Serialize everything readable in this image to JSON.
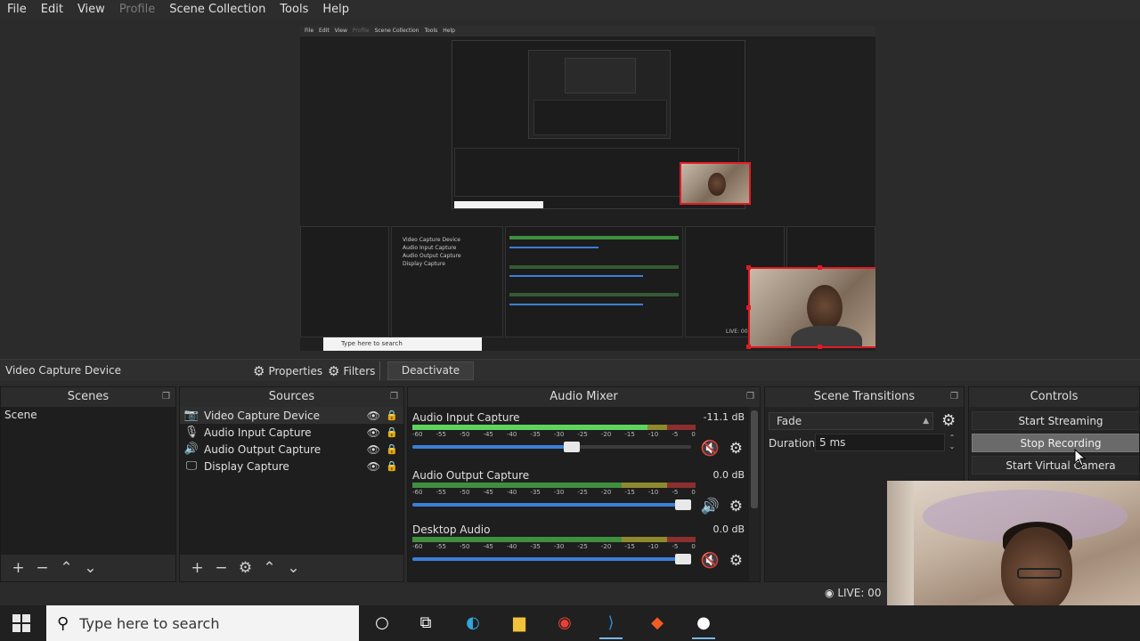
{
  "menu": [
    "File",
    "Edit",
    "View",
    "Profile",
    "Scene Collection",
    "Tools",
    "Help"
  ],
  "menu_disabled": [
    "Profile"
  ],
  "preview": {
    "nested_menu": [
      "File",
      "Edit",
      "View",
      "Profile",
      "Scene Collection",
      "Tools",
      "Help"
    ],
    "nested_search": "Type here to search",
    "nested_live": "LIVE: 00"
  },
  "source_toolbar": {
    "source_name": "Video Capture Device",
    "properties": "Properties",
    "filters": "Filters",
    "deactivate": "Deactivate"
  },
  "scenes": {
    "title": "Scenes",
    "items": [
      "Scene"
    ]
  },
  "sources": {
    "title": "Sources",
    "items": [
      {
        "label": "Video Capture Device",
        "icon": "camera-icon"
      },
      {
        "label": "Audio Input Capture",
        "icon": "microphone-icon"
      },
      {
        "label": "Audio Output Capture",
        "icon": "speaker-icon"
      },
      {
        "label": "Display Capture",
        "icon": "monitor-icon"
      }
    ]
  },
  "mixer": {
    "title": "Audio Mixer",
    "ticks": [
      "-60",
      "-55",
      "-50",
      "-45",
      "-40",
      "-35",
      "-30",
      "-25",
      "-20",
      "-15",
      "-10",
      "-5",
      "0"
    ],
    "channels": [
      {
        "name": "Audio Input Capture",
        "db": "-11.1 dB",
        "volume": 0.6,
        "level": 0.83,
        "muted": true
      },
      {
        "name": "Audio Output Capture",
        "db": "0.0 dB",
        "volume": 1.0,
        "level": 0,
        "muted": false
      },
      {
        "name": "Desktop Audio",
        "db": "0.0 dB",
        "volume": 1.0,
        "level": 0,
        "muted": true
      }
    ]
  },
  "transitions": {
    "title": "Scene Transitions",
    "selected": "Fade",
    "duration_label": "Duration",
    "duration_value": "5 ms"
  },
  "controls": {
    "title": "Controls",
    "start_streaming": "Start Streaming",
    "stop_recording": "Stop Recording",
    "start_virtual_camera": "Start Virtual Camera"
  },
  "status": {
    "live": "LIVE: 00"
  },
  "taskbar": {
    "search_placeholder": "Type here to search",
    "apps": [
      "cortana-icon",
      "task-view-icon",
      "edge-icon",
      "file-explorer-icon",
      "chrome-icon",
      "vscode-icon",
      "brave-icon",
      "obs-icon"
    ]
  },
  "colors": {
    "accent": "#3b7fd8",
    "selection_red": "#e01b24",
    "muted_red": "#d7262f",
    "taskbar": "#202020"
  }
}
